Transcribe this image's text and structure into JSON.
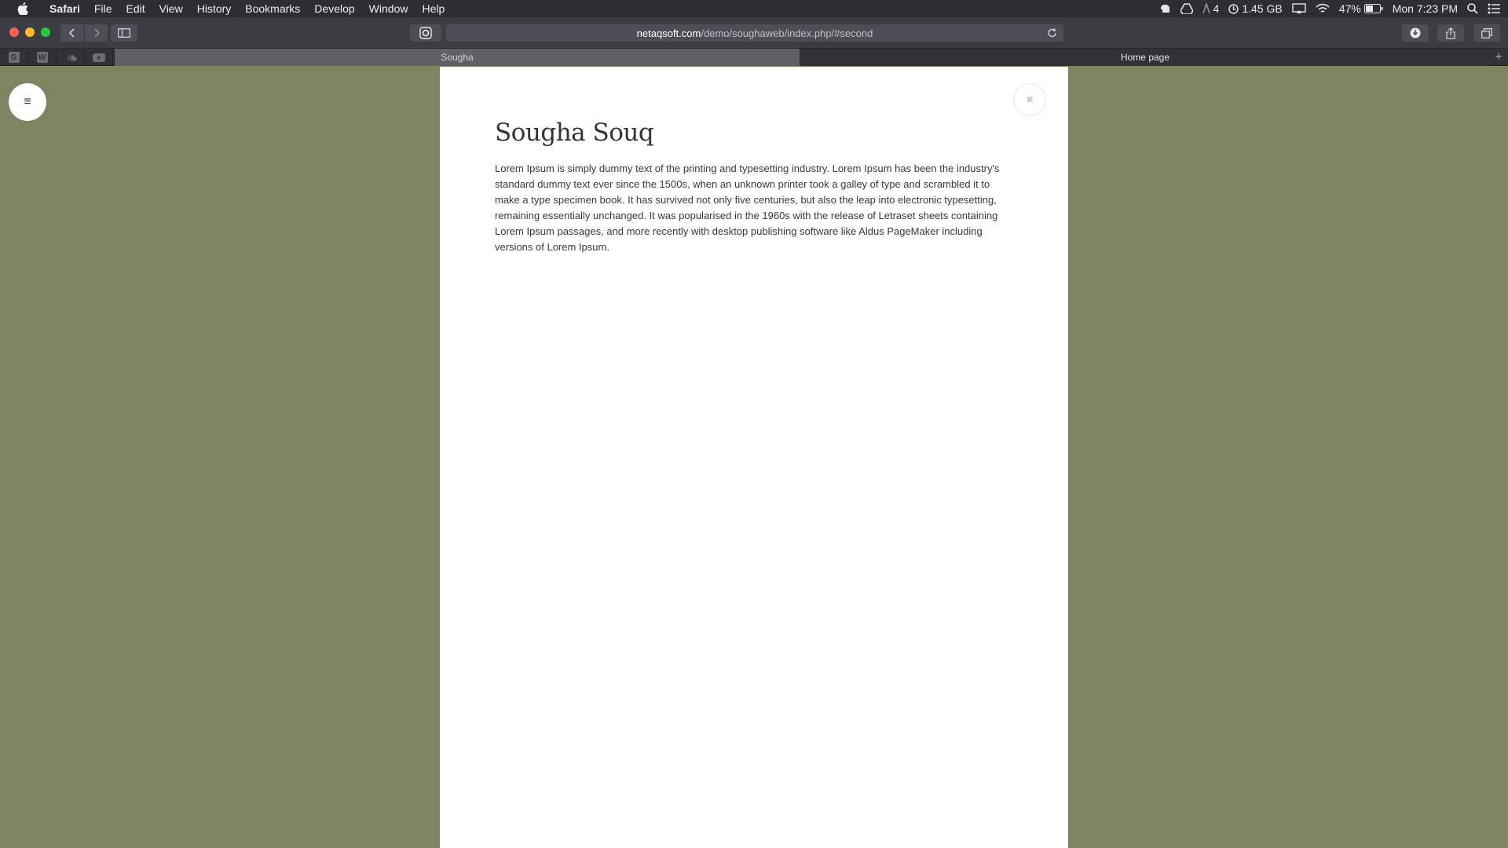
{
  "menubar": {
    "app_name": "Safari",
    "items": [
      "File",
      "Edit",
      "View",
      "History",
      "Bookmarks",
      "Develop",
      "Window",
      "Help"
    ],
    "status": {
      "notifications_count": "4",
      "memory": "1.45 GB",
      "battery": "47%",
      "clock": "Mon 7:23 PM"
    }
  },
  "toolbar": {
    "url_domain": "netaqsoft.com",
    "url_path": "/demo/soughaweb/index.php/#second"
  },
  "tabbar": {
    "pinned": [
      "G",
      "W",
      "",
      ""
    ],
    "tabs": [
      {
        "label": "Sougha",
        "active": true
      },
      {
        "label": "Home page",
        "active": false
      }
    ],
    "new_tab_symbol": "+"
  },
  "page": {
    "hamburger_symbol": "≡",
    "close_symbol": "✖",
    "title": "Sougha Souq",
    "paragraph": "Lorem Ipsum is simply dummy text of the printing and typesetting industry. Lorem Ipsum has been the industry's standard dummy text ever since the 1500s, when an unknown printer took a galley of type and scrambled it to make a type specimen book. It has survived not only five centuries, but also the leap into electronic typesetting, remaining essentially unchanged. It was popularised in the 1960s with the release of Letraset sheets containing Lorem Ipsum passages, and more recently with desktop publishing software like Aldus PageMaker including versions of Lorem Ipsum."
  },
  "colors": {
    "page_background": "#7e8361",
    "panel_background": "#ffffff",
    "menubar_background": "#2b2e33"
  },
  "icons": [
    "apple-icon",
    "evernote-icon",
    "drive-icon",
    "notifications-icon",
    "memory-icon",
    "airplay-icon",
    "wifi-icon",
    "battery-icon",
    "spotlight-icon",
    "notification-center-icon",
    "back-icon",
    "forward-icon",
    "sidebar-icon",
    "privacy-icon",
    "reload-icon",
    "downloads-icon",
    "share-icon",
    "tabs-overview-icon",
    "soundcloud-icon",
    "youtube-icon",
    "hamburger-icon",
    "close-icon"
  ]
}
